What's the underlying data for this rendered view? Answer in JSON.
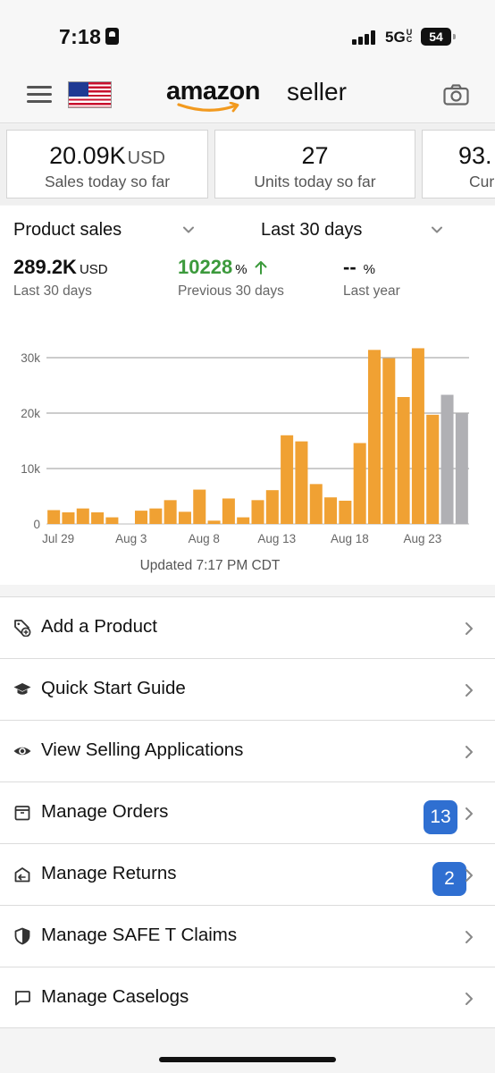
{
  "status_bar": {
    "time": "7:18",
    "network": "5G",
    "network_suffix": "UC",
    "battery": "54"
  },
  "header": {
    "logo_primary": "amazon",
    "logo_secondary": "seller",
    "flag": "us-flag-icon"
  },
  "kpis": [
    {
      "value": "20.09K",
      "unit": "USD",
      "label": "Sales today so far"
    },
    {
      "value": "27",
      "unit": "",
      "label": "Units today so far"
    },
    {
      "value": "93.",
      "unit": "",
      "label": "Curr"
    }
  ],
  "sales_panel": {
    "metric_dropdown": "Product sales",
    "period_dropdown": "Last 30 days",
    "stats": [
      {
        "value": "289.2K",
        "unit": "USD",
        "label": "Last 30 days"
      },
      {
        "value": "10228",
        "unit": "%",
        "label": "Previous 30 days",
        "trend": "up",
        "color": "#3c9a3c"
      },
      {
        "value": "--",
        "unit": "%",
        "label": "Last year"
      }
    ],
    "updated": "Updated 7:17 PM CDT"
  },
  "chart_data": {
    "type": "bar",
    "ylim": [
      0,
      30000
    ],
    "yticks": [
      "0",
      "10k",
      "20k",
      "30k"
    ],
    "ytick_values": [
      0,
      10000,
      20000,
      30000
    ],
    "x_tick_labels": [
      {
        "index": 0,
        "label": "Jul 29"
      },
      {
        "index": 5,
        "label": "Aug 3"
      },
      {
        "index": 10,
        "label": "Aug 8"
      },
      {
        "index": 15,
        "label": "Aug 13"
      },
      {
        "index": 20,
        "label": "Aug 18"
      },
      {
        "index": 25,
        "label": "Aug 23"
      }
    ],
    "values": [
      2500,
      2100,
      2800,
      2100,
      1200,
      0,
      2400,
      2800,
      4300,
      2200,
      6200,
      600,
      4600,
      1200,
      4300,
      6100,
      16000,
      14900,
      7200,
      4800,
      4200,
      14600,
      31400,
      29900,
      22900,
      31700,
      19700,
      23300,
      19900
    ],
    "bar_colors": {
      "actual": "#f0a133",
      "projected": "#b0b0b4"
    },
    "projected_from_index": 27,
    "grid": true
  },
  "menu": [
    {
      "label": "Add a Product",
      "icon": "tag-add-icon",
      "badge": ""
    },
    {
      "label": "Quick Start Guide",
      "icon": "graduation-cap-icon",
      "badge": ""
    },
    {
      "label": "View Selling Applications",
      "icon": "eye-icon",
      "badge": ""
    },
    {
      "label": "Manage Orders",
      "icon": "box-icon",
      "badge": "13"
    },
    {
      "label": "Manage Returns",
      "icon": "return-box-icon",
      "badge": "2"
    },
    {
      "label": "Manage SAFE T Claims",
      "icon": "shield-icon",
      "badge": ""
    },
    {
      "label": "Manage Caselogs",
      "icon": "chat-bubble-icon",
      "badge": ""
    }
  ]
}
